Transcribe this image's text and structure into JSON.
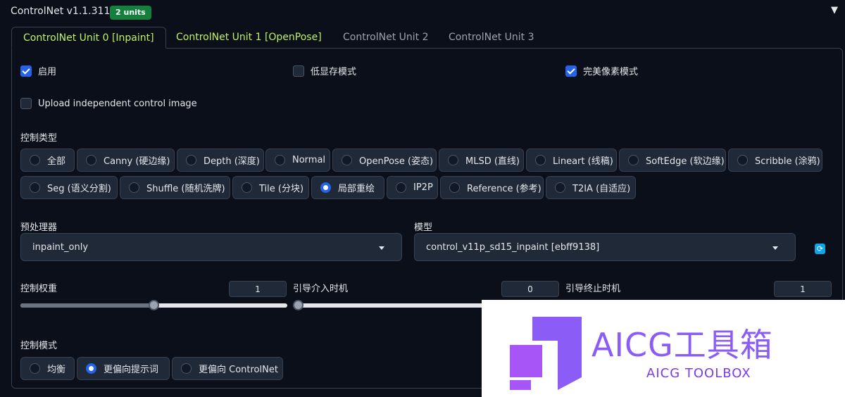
{
  "header": {
    "title": "ControlNet v1.1.311",
    "badge": "2 units",
    "collapse_icon": "triangle-down-icon"
  },
  "tabs": [
    {
      "label": "ControlNet Unit 0 [Inpaint]",
      "active": true
    },
    {
      "label": "ControlNet Unit 1 [OpenPose]",
      "active": false
    },
    {
      "label": "ControlNet Unit 2",
      "active": false
    },
    {
      "label": "ControlNet Unit 3",
      "active": false
    }
  ],
  "checkboxes": {
    "enable": {
      "label": "启用",
      "checked": true
    },
    "low_vram": {
      "label": "低显存模式",
      "checked": false
    },
    "pixel_perfect": {
      "label": "完美像素模式",
      "checked": true
    },
    "upload_independent": {
      "label": "Upload independent control image",
      "checked": false
    }
  },
  "control_type": {
    "label": "控制类型",
    "options": [
      "全部",
      "Canny (硬边缘)",
      "Depth (深度)",
      "Normal",
      "OpenPose (姿态)",
      "MLSD (直线)",
      "Lineart (线稿)",
      "SoftEdge (软边缘)",
      "Scribble (涂鸦)",
      "Seg (语义分割)",
      "Shuffle (随机洗牌)",
      "Tile (分块)",
      "局部重绘",
      "IP2P",
      "Reference (参考)",
      "T2IA (自适应)"
    ],
    "selected": "局部重绘"
  },
  "preprocessor": {
    "label": "预处理器",
    "value": "inpaint_only"
  },
  "model": {
    "label": "模型",
    "value": "control_v11p_sd15_inpaint [ebff9138]",
    "refresh_icon": "refresh-icon"
  },
  "sliders": {
    "weight": {
      "label": "控制权重",
      "value": "1",
      "level": 0.5
    },
    "start": {
      "label": "引导介入时机",
      "value": "0",
      "level": 0.0
    },
    "end": {
      "label": "引导终止时机",
      "value": "1",
      "level": 1.0
    }
  },
  "control_mode": {
    "label": "控制模式",
    "options": [
      "均衡",
      "更偏向提示词",
      "更偏向 ControlNet"
    ],
    "selected": "更偏向提示词"
  },
  "watermark": {
    "main": "AICG工具箱",
    "sub": "AICG TOOLBOX",
    "color": "#8b5cf6"
  }
}
